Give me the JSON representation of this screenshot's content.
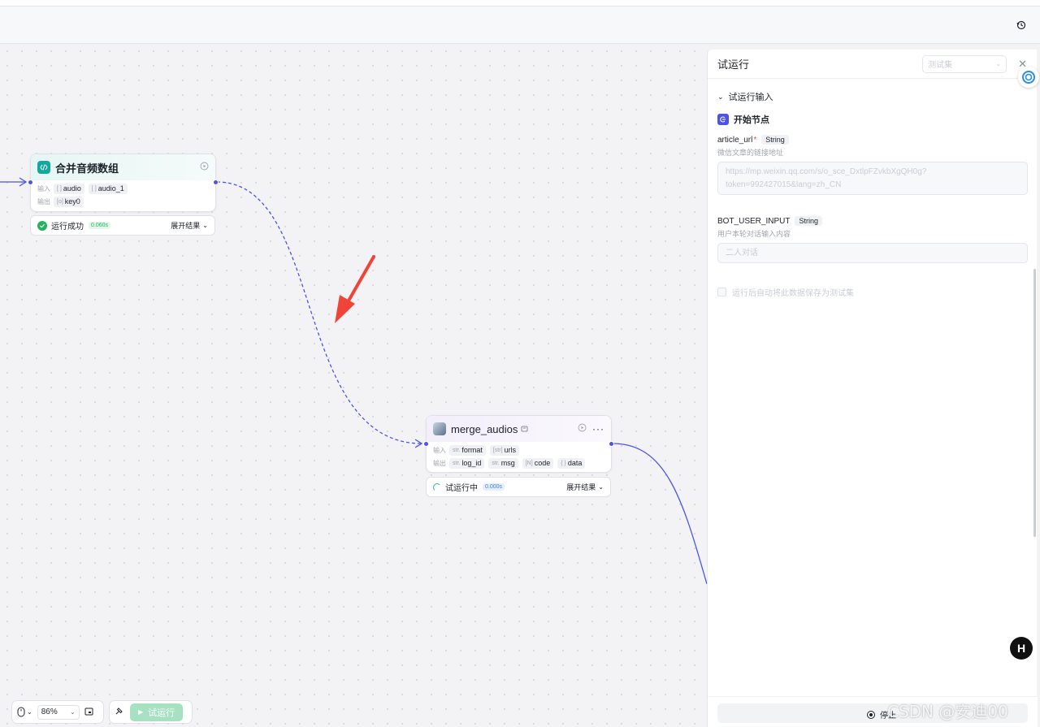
{
  "colors": {
    "accent": "#4d53e8",
    "arrow": "#f04438",
    "success": "#22b35e",
    "run_button": "#a6e2c2"
  },
  "icons": {
    "history": "history-icon",
    "code": "code-icon",
    "plugin": "plugin-icon",
    "start": "start-node-icon"
  },
  "nodes": {
    "merge_array": {
      "title": "合并音频数组",
      "input_label": "输入",
      "inputs": [
        {
          "type": "[ ]",
          "name": "audio"
        },
        {
          "type": "[ ]",
          "name": "audio_1"
        }
      ],
      "output_label": "输出",
      "outputs": [
        {
          "type": "[o]",
          "name": "key0"
        }
      ],
      "status_text": "运行成功",
      "status_time": "0.060s",
      "expand_label": "展开结果"
    },
    "merge_audios": {
      "title": "merge_audios",
      "input_label": "输入",
      "inputs": [
        {
          "type": "str.",
          "name": "format"
        },
        {
          "type": "[str]",
          "name": "urls"
        }
      ],
      "output_label": "输出",
      "outputs": [
        {
          "type": "str.",
          "name": "log_id"
        },
        {
          "type": "str.",
          "name": "msg"
        },
        {
          "type": "[N]",
          "name": "code"
        },
        {
          "type": "{ }",
          "name": "data"
        }
      ],
      "status_text": "试运行中",
      "status_time": "0.000s",
      "expand_label": "展开结果"
    }
  },
  "toolbar": {
    "zoom": "86%",
    "run_label": "试运行"
  },
  "panel": {
    "title": "试运行",
    "testset_placeholder": "测试集",
    "section_title": "试运行输入",
    "start_node": "开始节点",
    "fields": [
      {
        "name": "article_url",
        "required": "*",
        "type": "String",
        "description": "微信文章的链接地址",
        "value_line1": "https://mp.weixin.qq.com/s/o_sce_DxtlpFZvkbXgQH0g?",
        "value_line2": "token=992427015&lang=zh_CN"
      },
      {
        "name": "BOT_USER_INPUT",
        "type": "String",
        "description": "用户本轮对话输入内容",
        "value": "二人对话"
      }
    ],
    "save_checkbox": "运行后自动将此数据保存为测试集",
    "stop_label": "停止"
  },
  "watermark": "CSDN @安迪00"
}
